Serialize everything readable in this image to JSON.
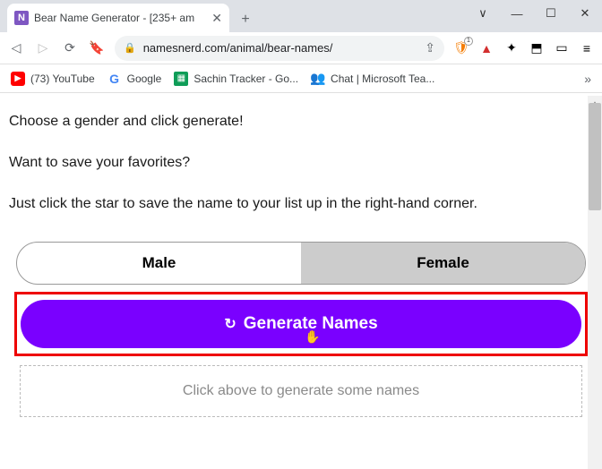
{
  "window": {
    "tab_title": "Bear Name Generator - [235+ am",
    "minimize": "—",
    "maximize": "☐",
    "close": "✕",
    "newtab": "+",
    "tabclose": "✕",
    "drop": "∨"
  },
  "toolbar": {
    "url_display": "namesnerd.com/animal/bear-names/",
    "lock": "🔒"
  },
  "bookmarks": {
    "youtube": "(73) YouTube",
    "google": "Google",
    "sheets": "Sachin Tracker - Go...",
    "teams": "Chat | Microsoft Tea...",
    "more": "»"
  },
  "page": {
    "line1": "Choose a gender and click generate!",
    "line2": "Want to save your favorites?",
    "line3": "Just click the star to save the name to your list up in the right-hand corner.",
    "tab_male": "Male",
    "tab_female": "Female",
    "generate": "Generate Names",
    "placeholder": "Click above to generate some names"
  }
}
